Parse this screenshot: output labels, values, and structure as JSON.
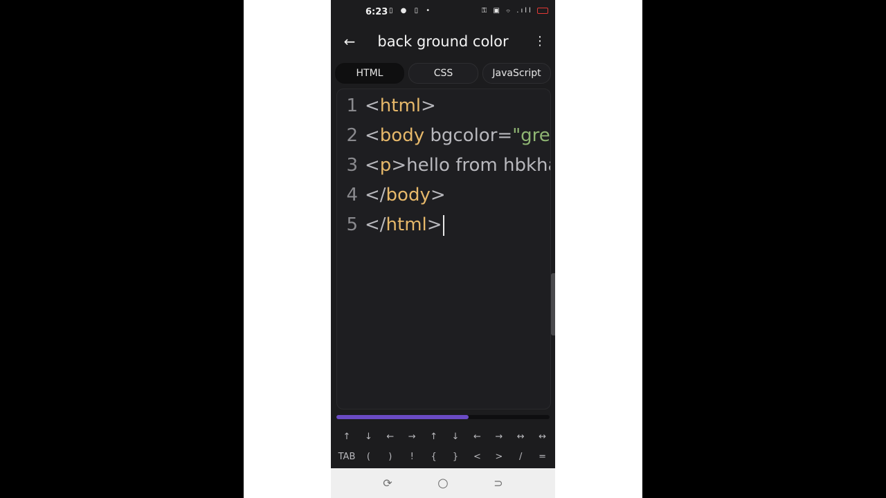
{
  "status_bar": {
    "time": "6:23",
    "left_icons": "▯ ● ▯ •",
    "right_icons": "⚿ ▣ ⌔ .ıll"
  },
  "app_bar": {
    "title": "back ground color",
    "back_icon": "←",
    "more_icon": "⋮"
  },
  "tabs": [
    {
      "label": "HTML",
      "active": true
    },
    {
      "label": "CSS",
      "active": false
    },
    {
      "label": "JavaScript",
      "active": false
    }
  ],
  "editor": {
    "lines": [
      {
        "no": "1",
        "tokens": [
          {
            "t": "<",
            "c": "punct"
          },
          {
            "t": "html",
            "c": "tag"
          },
          {
            "t": ">",
            "c": "punct"
          }
        ]
      },
      {
        "no": "2",
        "tokens": [
          {
            "t": "<",
            "c": "punct"
          },
          {
            "t": "body",
            "c": "tag"
          },
          {
            "t": " bgcolor=",
            "c": "attr"
          },
          {
            "t": "\"gree",
            "c": "str"
          }
        ]
      },
      {
        "no": "3",
        "tokens": [
          {
            "t": "<",
            "c": "punct"
          },
          {
            "t": "p",
            "c": "tag"
          },
          {
            "t": ">hello from hbkha",
            "c": "text"
          }
        ]
      },
      {
        "no": "4",
        "tokens": [
          {
            "t": "</",
            "c": "punct"
          },
          {
            "t": "body",
            "c": "tag"
          },
          {
            "t": ">",
            "c": "punct"
          }
        ]
      },
      {
        "no": "5",
        "tokens": [
          {
            "t": "</",
            "c": "punct"
          },
          {
            "t": "html",
            "c": "tag"
          },
          {
            "t": ">",
            "c": "punct"
          }
        ]
      }
    ],
    "run_icon": "▶"
  },
  "progress": {
    "fraction": 0.62
  },
  "extra_keys": {
    "row1": [
      "↑",
      "↓",
      "←",
      "→",
      "↑",
      "↓",
      "←",
      "→",
      "↔",
      "↔"
    ],
    "row2": [
      "TAB",
      "(",
      ")",
      "!",
      "{",
      "}",
      "<",
      ">",
      "/",
      "="
    ]
  },
  "nav_bar": {
    "recents_icon": "⟳",
    "home_icon": "○",
    "back_icon": "⊃"
  },
  "colors": {
    "tag": "#e6b86a",
    "string": "#8fb573",
    "accent": "#5b3f9e",
    "progress": "#6a4bc4",
    "background": "#1c1c1e"
  }
}
